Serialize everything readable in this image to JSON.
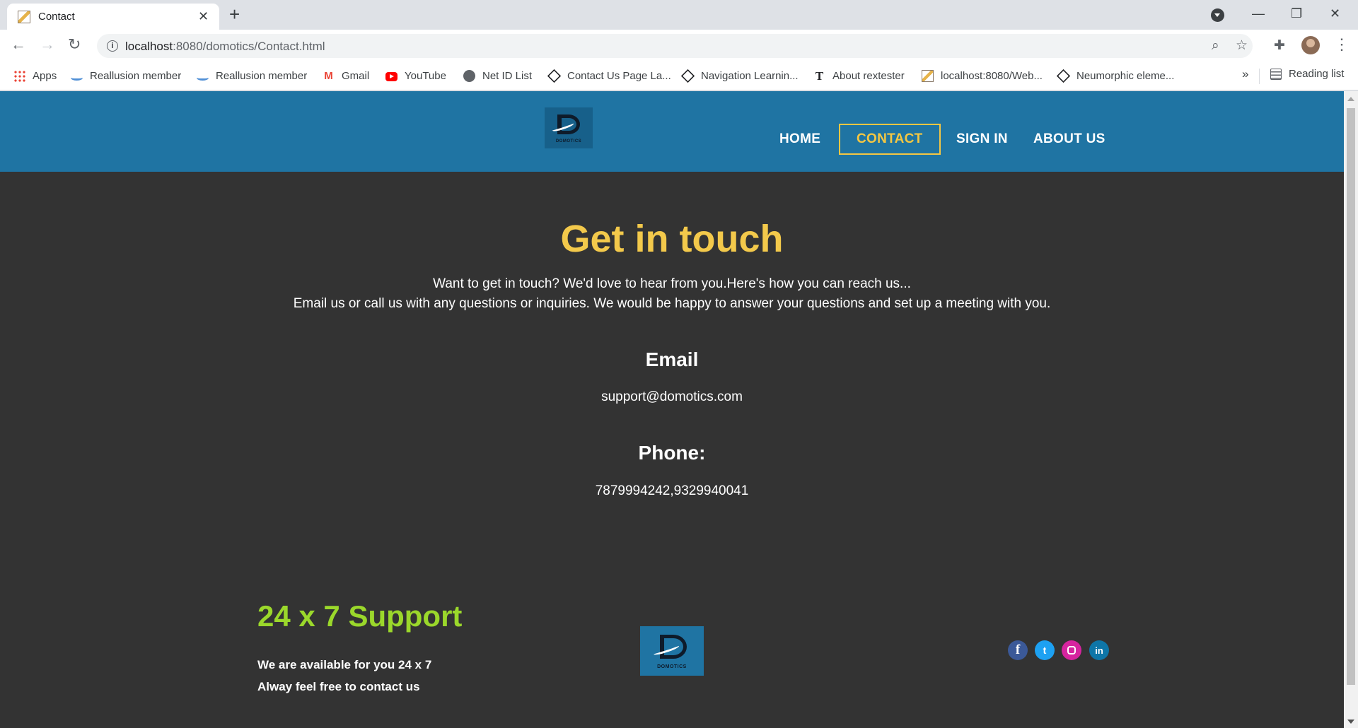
{
  "browser": {
    "tab_title": "Contact",
    "url_host": "localhost",
    "url_rest": ":8080/domotics/Contact.html",
    "bookmarks": [
      {
        "label": "Apps",
        "icon": "apps-grid-icon"
      },
      {
        "label": "Reallusion member",
        "icon": "reallusion-icon"
      },
      {
        "label": "Reallusion member",
        "icon": "reallusion-icon"
      },
      {
        "label": "Gmail",
        "icon": "gmail-icon"
      },
      {
        "label": "YouTube",
        "icon": "youtube-icon"
      },
      {
        "label": "Net ID List",
        "icon": "globe-icon"
      },
      {
        "label": "Contact Us Page La...",
        "icon": "codepen-icon"
      },
      {
        "label": "Navigation Learnin...",
        "icon": "codepen-icon"
      },
      {
        "label": "About rextester",
        "icon": "rextester-icon"
      },
      {
        "label": "localhost:8080/Web...",
        "icon": "page-image-icon"
      },
      {
        "label": "Neumorphic eleme...",
        "icon": "codepen-icon"
      }
    ],
    "more_bookmarks": "»",
    "reading_list": "Reading list"
  },
  "site": {
    "logo_text": "DOMOTICS",
    "nav": {
      "home": "HOME",
      "contact": "CONTACT",
      "signin": "SIGN IN",
      "about": "ABOUT US"
    },
    "headline": "Get in touch",
    "intro_line1": "Want to get in touch? We'd love to hear from you.Here's how you can reach us...",
    "intro_line2": "Email us or call us with any questions or inquiries. We would be happy to answer your questions and set up a meeting with you.",
    "email_title": "Email",
    "email_value": "support@domotics.com",
    "phone_title": "Phone:",
    "phone_value": "7879994242,9329940041",
    "footer": {
      "support_title": "24 x 7 Support",
      "support_line1": "We are available for you 24 x 7",
      "support_line2": "Alway feel free to contact us"
    },
    "social": {
      "facebook": "f",
      "twitter": "t",
      "linkedin": "in"
    },
    "colors": {
      "header_bg": "#1f74a3",
      "page_bg": "#333333",
      "accent_yellow": "#f3c94b",
      "accent_green": "#9bd82b"
    }
  }
}
